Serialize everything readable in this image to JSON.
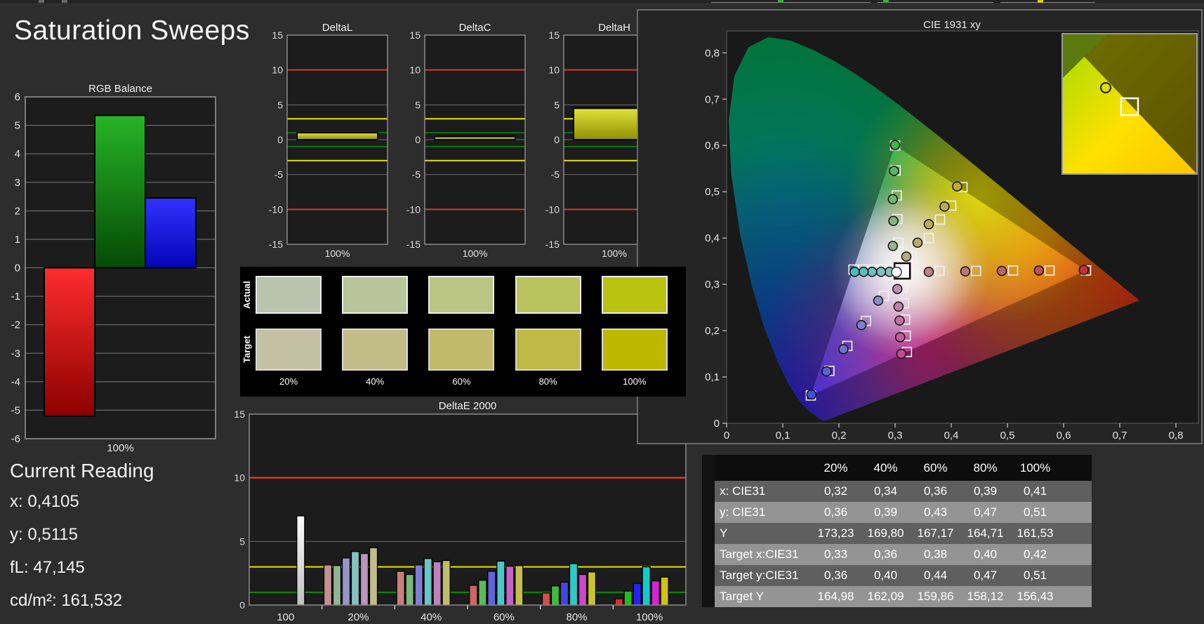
{
  "app": {
    "title": "Saturation Sweeps"
  },
  "current_reading": {
    "title": "Current Reading",
    "lines": [
      "x: 0,4105",
      "y: 0,5115",
      "fL: 47,145",
      "cd/m²: 161,532"
    ]
  },
  "swatch_panel": {
    "row_labels": [
      "Actual",
      "Target"
    ],
    "column_labels": [
      "20%",
      "40%",
      "60%",
      "80%",
      "100%"
    ],
    "actual_colors": [
      "#b9c3ad",
      "#b9c49b",
      "#bac483",
      "#bbc35e",
      "#b9c20e"
    ],
    "target_colors": [
      "#c3c0a4",
      "#c2bd88",
      "#c1ba6a",
      "#c0b945",
      "#bdb700"
    ]
  },
  "table": {
    "header": [
      "",
      "20%",
      "40%",
      "60%",
      "80%",
      "100%"
    ],
    "rows": [
      {
        "label": "x: CIE31",
        "values": [
          "0,32",
          "0,34",
          "0,36",
          "0,39",
          "0,41"
        ]
      },
      {
        "label": "y: CIE31",
        "values": [
          "0,36",
          "0,39",
          "0,43",
          "0,47",
          "0,51"
        ]
      },
      {
        "label": "Y",
        "values": [
          "173,23",
          "169,80",
          "167,17",
          "164,71",
          "161,53"
        ]
      },
      {
        "label": "Target x:CIE31",
        "values": [
          "0,33",
          "0,36",
          "0,38",
          "0,40",
          "0,42"
        ]
      },
      {
        "label": "Target y:CIE31",
        "values": [
          "0,36",
          "0,40",
          "0,44",
          "0,47",
          "0,51"
        ]
      },
      {
        "label": "Target Y",
        "values": [
          "164,98",
          "162,09",
          "159,86",
          "158,12",
          "156,43"
        ]
      }
    ],
    "row_colors": [
      "#5f5f5f",
      "#949494"
    ],
    "header_bg": "#0d0d0d",
    "gutter_bg": "#121212"
  },
  "chart_data": [
    {
      "id": "rgb_balance",
      "type": "bar",
      "title": "RGB Balance",
      "xlabel": "100%",
      "categories": [
        "Red",
        "Green",
        "Blue"
      ],
      "values": [
        -5.2,
        5.35,
        2.45
      ],
      "bar_colors_top": [
        "#ff2d2d",
        "#27b527",
        "#3333ff"
      ],
      "bar_colors_bottom": [
        "#8c0100",
        "#064a06",
        "#0404b8"
      ],
      "ylim": [
        -6,
        6
      ],
      "ytick_step": 1,
      "grid": true
    },
    {
      "id": "delta_l",
      "type": "bar",
      "title": "DeltaL",
      "xlabel": "100%",
      "values": [
        1.0
      ],
      "ylim": [
        -15,
        15
      ],
      "yticks": [
        15,
        10,
        5,
        0,
        -5,
        -10,
        -15
      ],
      "limit_lines": {
        "red": 10,
        "yellow": 3,
        "green": 1
      },
      "bar_color_top": "#e2e23c",
      "bar_color_bottom": "#8f8f03"
    },
    {
      "id": "delta_c",
      "type": "bar",
      "title": "DeltaC",
      "xlabel": "100%",
      "values": [
        0.45
      ],
      "ylim": [
        -15,
        15
      ],
      "yticks": [
        15,
        10,
        5,
        0,
        -5,
        -10,
        -15
      ],
      "limit_lines": {
        "red": 10,
        "yellow": 3,
        "green": 1
      },
      "bar_color_top": "#e2e23c",
      "bar_color_bottom": "#8f8f03"
    },
    {
      "id": "delta_h",
      "type": "bar",
      "title": "DeltaH",
      "xlabel": "100%",
      "values": [
        4.5
      ],
      "ylim": [
        -15,
        15
      ],
      "yticks": [
        15,
        10,
        5,
        0,
        -5,
        -10,
        -15
      ],
      "limit_lines": {
        "red": 10,
        "yellow": 3,
        "green": 1
      },
      "bar_color_top": "#e2e23c",
      "bar_color_bottom": "#8f8f03"
    },
    {
      "id": "delta_e_2000",
      "type": "bar",
      "title": "DeltaE 2000",
      "ylim": [
        0,
        15
      ],
      "yticks": [
        0,
        5,
        10,
        15
      ],
      "limit_lines": {
        "red": 10,
        "yellow": 3,
        "green": 1
      },
      "groups": [
        {
          "label": "100",
          "values": [
            7.0
          ],
          "colors": [
            "#f2f2f2"
          ]
        },
        {
          "label": "20%",
          "values": [
            3.15,
            3.1,
            3.7,
            4.2,
            4.05,
            4.5
          ],
          "colors": [
            "#c49191",
            "#91b591",
            "#9595cc",
            "#84c2c2",
            "#bb93bb",
            "#c0bd8a"
          ]
        },
        {
          "label": "40%",
          "values": [
            2.65,
            2.4,
            3.15,
            3.65,
            3.4,
            3.5
          ],
          "colors": [
            "#c97f7f",
            "#7cb87c",
            "#7f7fd4",
            "#6cc4c4",
            "#c07fc0",
            "#c0bd6a"
          ]
        },
        {
          "label": "60%",
          "values": [
            1.55,
            1.95,
            2.65,
            3.45,
            3.05,
            3.1
          ],
          "colors": [
            "#cf6666",
            "#5cba5c",
            "#6262dd",
            "#4cc7c7",
            "#c862c8",
            "#c4bf4a"
          ]
        },
        {
          "label": "80%",
          "values": [
            0.95,
            1.5,
            1.8,
            3.25,
            2.4,
            2.6
          ],
          "colors": [
            "#d54d4d",
            "#3dbc3d",
            "#4444e4",
            "#2fc9c9",
            "#d044d0",
            "#c9c12e"
          ]
        },
        {
          "label": "100%",
          "values": [
            0.5,
            1.1,
            1.7,
            3.0,
            1.9,
            2.2
          ],
          "colors": [
            "#dd2d2d",
            "#1fbe1f",
            "#2424ee",
            "#12cccc",
            "#d822d8",
            "#cfc412"
          ]
        }
      ]
    },
    {
      "id": "cie_1931",
      "type": "scatter",
      "title": "CIE 1931 xy",
      "xlim": [
        0,
        0.84
      ],
      "ylim": [
        0,
        0.847
      ],
      "xtick_labels": [
        "0",
        "0,1",
        "0,2",
        "0,3",
        "0,4",
        "0,5",
        "0,6",
        "0,7",
        "0,8"
      ],
      "ytick_labels": [
        "0",
        "0,1",
        "0,2",
        "0,3",
        "0,4",
        "0,5",
        "0,6",
        "0,7",
        "0,8"
      ],
      "white_point": {
        "target": [
          0.3127,
          0.329
        ],
        "measured": [
          0.3025,
          0.3265
        ]
      },
      "gamut_triangle": [
        [
          0.64,
          0.33
        ],
        [
          0.3,
          0.6
        ],
        [
          0.15,
          0.06
        ]
      ],
      "series": [
        {
          "name": "red",
          "targets": [
            [
              0.379,
              0.329
            ],
            [
              0.444,
              0.329
            ],
            [
              0.51,
              0.33
            ],
            [
              0.575,
              0.33
            ],
            [
              0.64,
              0.33
            ]
          ],
          "measured": [
            [
              0.36,
              0.327
            ],
            [
              0.425,
              0.328
            ],
            [
              0.49,
              0.329
            ],
            [
              0.556,
              0.33
            ],
            [
              0.636,
              0.331
            ]
          ],
          "point_colors": [
            "#b98585",
            "#bb7777",
            "#bd6666",
            "#c05151",
            "#c43434"
          ]
        },
        {
          "name": "green",
          "targets": [
            [
              0.306,
              0.39
            ],
            [
              0.304,
              0.441
            ],
            [
              0.303,
              0.492
            ],
            [
              0.301,
              0.546
            ],
            [
              0.3,
              0.6
            ]
          ],
          "measured": [
            [
              0.296,
              0.383
            ],
            [
              0.297,
              0.437
            ],
            [
              0.296,
              0.484
            ],
            [
              0.298,
              0.545
            ],
            [
              0.3,
              0.601
            ]
          ],
          "point_colors": [
            "#96b392",
            "#86b383",
            "#73b472",
            "#5eb560",
            "#42b648"
          ]
        },
        {
          "name": "blue",
          "targets": [
            [
              0.28,
              0.275
            ],
            [
              0.248,
              0.221
            ],
            [
              0.215,
              0.167
            ],
            [
              0.183,
              0.113
            ],
            [
              0.15,
              0.06
            ]
          ],
          "measured": [
            [
              0.27,
              0.265
            ],
            [
              0.24,
              0.212
            ],
            [
              0.208,
              0.16
            ],
            [
              0.178,
              0.112
            ],
            [
              0.151,
              0.062
            ]
          ],
          "point_colors": [
            "#8a90c4",
            "#7b82c9",
            "#6a73ce",
            "#5862d4",
            "#4450db"
          ]
        },
        {
          "name": "cyan",
          "targets": [
            [
              0.2955,
              0.332
            ],
            [
              0.278,
              0.332
            ],
            [
              0.261,
              0.332
            ],
            [
              0.243,
              0.332
            ],
            [
              0.226,
              0.332
            ]
          ],
          "measured": [
            [
              0.29,
              0.327
            ],
            [
              0.275,
              0.327
            ],
            [
              0.259,
              0.327
            ],
            [
              0.244,
              0.327
            ],
            [
              0.228,
              0.327
            ]
          ],
          "point_colors": [
            "#8fbfbf",
            "#80bfbf",
            "#6fbfbf",
            "#5cbfbf",
            "#45bfbf"
          ]
        },
        {
          "name": "magenta",
          "targets": [
            [
              0.314,
              0.294
            ],
            [
              0.316,
              0.259
            ],
            [
              0.318,
              0.224
            ],
            [
              0.319,
              0.189
            ],
            [
              0.321,
              0.154
            ]
          ],
          "measured": [
            [
              0.304,
              0.29
            ],
            [
              0.306,
              0.252
            ],
            [
              0.308,
              0.222
            ],
            [
              0.309,
              0.186
            ],
            [
              0.311,
              0.15
            ]
          ],
          "point_colors": [
            "#bd8fb0",
            "#be81a9",
            "#bf71a3",
            "#c05f9c",
            "#c24a94"
          ]
        },
        {
          "name": "yellow",
          "targets": [
            [
              0.33,
              0.36
            ],
            [
              0.36,
              0.4
            ],
            [
              0.38,
              0.44
            ],
            [
              0.4,
              0.47
            ],
            [
              0.42,
              0.51
            ]
          ],
          "measured": [
            [
              0.32,
              0.36
            ],
            [
              0.34,
              0.39
            ],
            [
              0.36,
              0.43
            ],
            [
              0.388,
              0.468
            ],
            [
              0.4105,
              0.5115
            ]
          ],
          "point_colors": [
            "#b5ad7e",
            "#b7ac6f",
            "#b9ab5f",
            "#bbaa4c",
            "#beaa35"
          ]
        }
      ],
      "spectral_locus": [
        [
          0.1741,
          0.005
        ],
        [
          0.166,
          0.009
        ],
        [
          0.1566,
          0.0177
        ],
        [
          0.144,
          0.0297
        ],
        [
          0.1355,
          0.0399
        ],
        [
          0.1241,
          0.0578
        ],
        [
          0.1096,
          0.0868
        ],
        [
          0.0913,
          0.1327
        ],
        [
          0.0687,
          0.2007
        ],
        [
          0.0454,
          0.295
        ],
        [
          0.0235,
          0.4127
        ],
        [
          0.0082,
          0.5384
        ],
        [
          0.0039,
          0.6548
        ],
        [
          0.0139,
          0.7502
        ],
        [
          0.0389,
          0.812
        ],
        [
          0.0743,
          0.8338
        ],
        [
          0.1142,
          0.8262
        ],
        [
          0.1547,
          0.8059
        ],
        [
          0.1929,
          0.7816
        ],
        [
          0.2296,
          0.7543
        ],
        [
          0.2658,
          0.7243
        ],
        [
          0.3016,
          0.6923
        ],
        [
          0.3373,
          0.6589
        ],
        [
          0.3731,
          0.6245
        ],
        [
          0.4087,
          0.5896
        ],
        [
          0.4441,
          0.5547
        ],
        [
          0.4788,
          0.5202
        ],
        [
          0.5125,
          0.4866
        ],
        [
          0.5448,
          0.4544
        ],
        [
          0.5752,
          0.4242
        ],
        [
          0.6029,
          0.3965
        ],
        [
          0.627,
          0.3725
        ],
        [
          0.6482,
          0.3514
        ],
        [
          0.6658,
          0.334
        ],
        [
          0.6801,
          0.3197
        ],
        [
          0.6915,
          0.3083
        ],
        [
          0.7006,
          0.2993
        ],
        [
          0.7079,
          0.292
        ],
        [
          0.714,
          0.2859
        ],
        [
          0.719,
          0.2809
        ],
        [
          0.723,
          0.277
        ],
        [
          0.726,
          0.274
        ],
        [
          0.7283,
          0.2717
        ],
        [
          0.73,
          0.27
        ],
        [
          0.732,
          0.268
        ],
        [
          0.7334,
          0.2666
        ],
        [
          0.7347,
          0.2653
        ]
      ],
      "inset": {
        "circle": [
          0.41,
          0.5115
        ],
        "square": [
          0.42,
          0.51
        ]
      }
    }
  ],
  "colors": {
    "background": "#2d2d2d",
    "plot_bg": "#1c1c1c",
    "grid": "#6e6e6e",
    "border": "#9a9a9a",
    "text": "#e8e8e8",
    "limit_red": "#d23a2a",
    "limit_yellow": "#e6e600",
    "limit_green": "#0f8a0f"
  }
}
